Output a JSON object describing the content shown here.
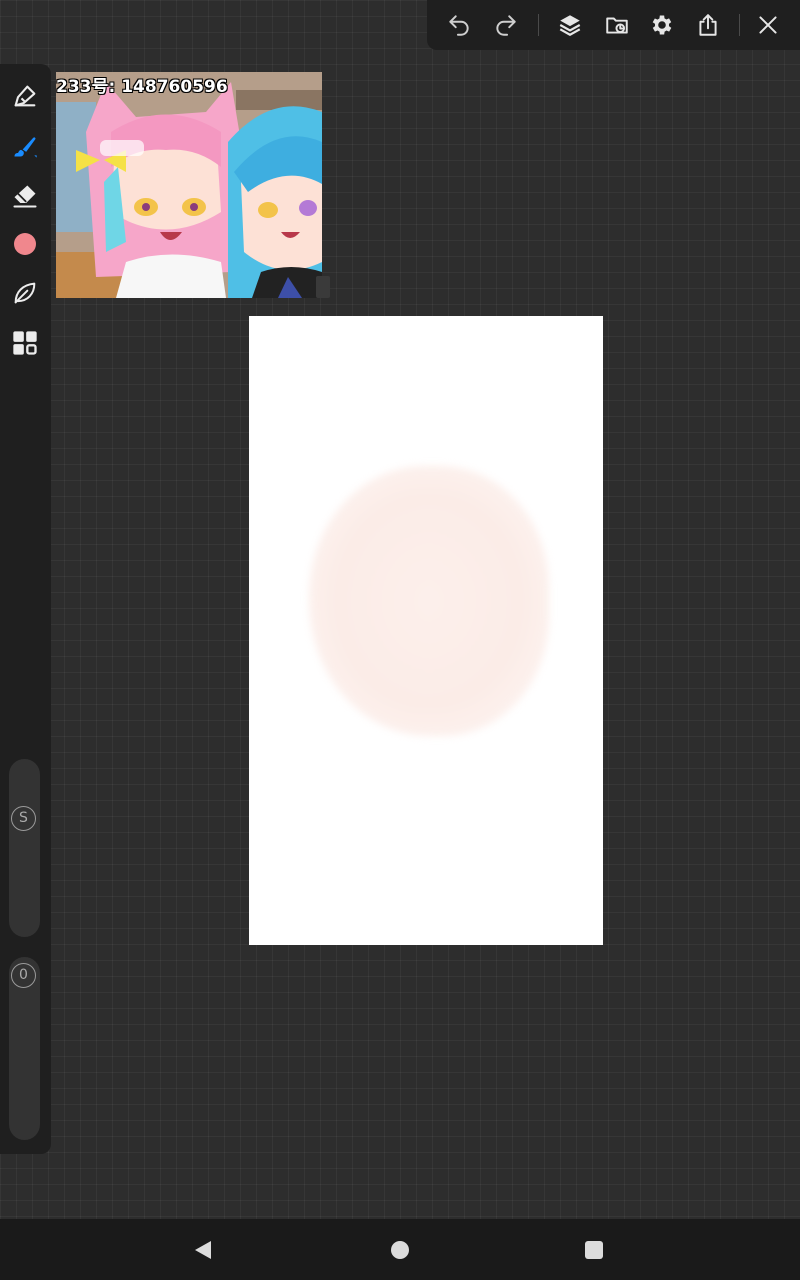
{
  "toolbar": {
    "icons": [
      "undo-icon",
      "redo-icon",
      "layers-icon",
      "import-icon",
      "gear-icon",
      "share-icon",
      "close-icon"
    ]
  },
  "tools": {
    "icons": [
      "pen-icon",
      "brush-icon",
      "eraser-icon",
      "color-swatch",
      "smudge-icon",
      "gallery-icon"
    ],
    "active": "brush-icon",
    "current_color": "#f0878d",
    "accent_color": "#1a8cff"
  },
  "sliders": {
    "size_label": "S",
    "opacity_label": "0"
  },
  "reference": {
    "caption": "233号: 148760596"
  },
  "canvas": {
    "background": "#ffffff",
    "stroke_color": "#fbece7"
  }
}
